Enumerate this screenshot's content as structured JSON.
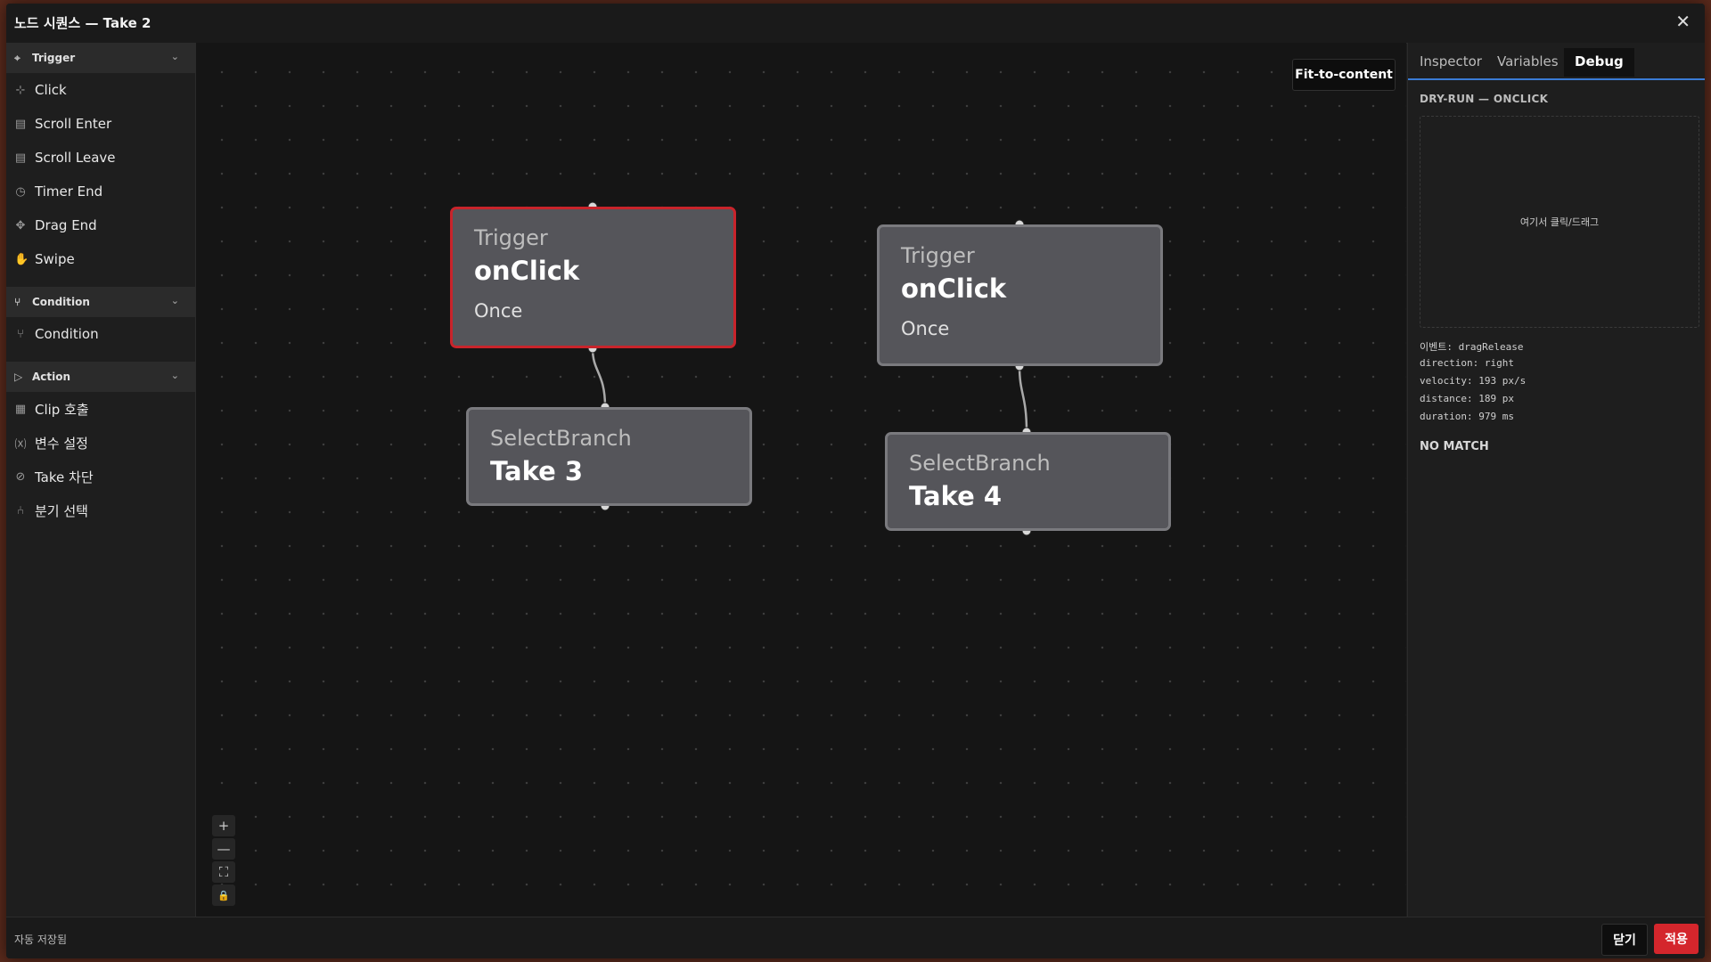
{
  "window": {
    "title": "노드 시퀀스 — Take 2",
    "close_glyph": "✕"
  },
  "sidebar": {
    "sections": [
      {
        "label": "Trigger",
        "icon": "trigger-icon",
        "items": [
          {
            "label": "Click",
            "icon": "click-icon"
          },
          {
            "label": "Scroll Enter",
            "icon": "scroll-enter-icon"
          },
          {
            "label": "Scroll Leave",
            "icon": "scroll-leave-icon"
          },
          {
            "label": "Timer End",
            "icon": "timer-icon"
          },
          {
            "label": "Drag End",
            "icon": "drag-icon"
          },
          {
            "label": "Swipe",
            "icon": "swipe-icon"
          }
        ]
      },
      {
        "label": "Condition",
        "icon": "condition-icon",
        "items": [
          {
            "label": "Condition",
            "icon": "condition-icon"
          }
        ]
      },
      {
        "label": "Action",
        "icon": "action-icon",
        "items": [
          {
            "label": "Clip 호출",
            "icon": "clip-icon"
          },
          {
            "label": "변수 설정",
            "icon": "variable-icon"
          },
          {
            "label": "Take 차단",
            "icon": "block-icon"
          },
          {
            "label": "분기 선택",
            "icon": "branch-icon"
          }
        ]
      }
    ]
  },
  "canvas": {
    "fit_label": "Fit-to-content",
    "nodes": [
      {
        "type": "Trigger",
        "name": "onClick",
        "mode": "Once",
        "selected": true
      },
      {
        "type": "SelectBranch",
        "name": "Take 3"
      },
      {
        "type": "Trigger",
        "name": "onClick",
        "mode": "Once",
        "selected": false
      },
      {
        "type": "SelectBranch",
        "name": "Take 4"
      }
    ],
    "zoom_controls": [
      "+",
      "—",
      "⛶",
      "🔒"
    ]
  },
  "right_panel": {
    "tabs": [
      "Inspector",
      "Variables",
      "Debug"
    ],
    "active_tab": "Debug",
    "dry_run_title": "DRY-RUN — ONCLICK",
    "drop_hint": "여기서 클릭/드래그",
    "debug_lines": [
      "이벤트: dragRelease",
      "direction: right",
      "velocity: 193 px/s",
      "distance: 189 px",
      "duration: 979 ms"
    ],
    "result": "NO MATCH"
  },
  "footer": {
    "autosave": "자동 저장됨",
    "close_label": "닫기",
    "apply_label": "적용"
  },
  "colors": {
    "accent": "#d4262c",
    "tab_underline": "#3a7bd5",
    "node_fill": "#55555a",
    "node_border": "#7a7a7e"
  }
}
